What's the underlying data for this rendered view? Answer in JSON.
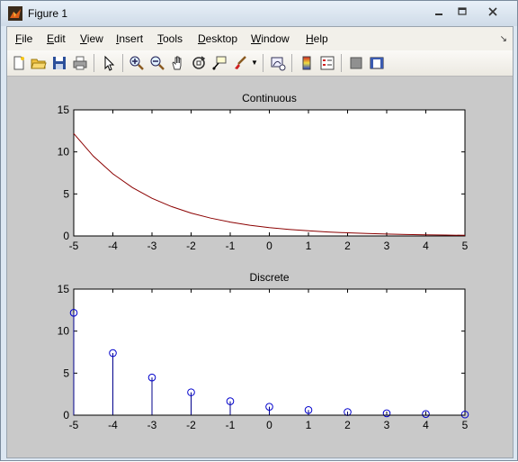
{
  "window": {
    "title": "Figure 1",
    "controls": [
      "minimize",
      "maximize",
      "close"
    ]
  },
  "menu": {
    "items": [
      {
        "label": "File",
        "accel": "F",
        "rest": "ile"
      },
      {
        "label": "Edit",
        "accel": "E",
        "rest": "dit"
      },
      {
        "label": "View",
        "accel": "V",
        "rest": "iew"
      },
      {
        "label": "Insert",
        "accel": "I",
        "rest": "nsert"
      },
      {
        "label": "Tools",
        "accel": "T",
        "rest": "ools"
      },
      {
        "label": "Desktop",
        "accel": "D",
        "rest": "esktop"
      },
      {
        "label": "Window",
        "accel": "W",
        "rest": "indow"
      },
      {
        "label": "Help",
        "accel": "H",
        "rest": "elp"
      }
    ]
  },
  "toolbar": {
    "icons": [
      "new-figure-icon",
      "open-file-icon",
      "save-icon",
      "print-icon",
      "pointer-icon",
      "zoom-in-icon",
      "zoom-out-icon",
      "pan-icon",
      "rotate-3d-icon",
      "data-cursor-icon",
      "brush-icon",
      "link-plot-icon",
      "colorbar-icon",
      "legend-icon",
      "hide-plot-tools-icon",
      "show-plot-tools-icon"
    ]
  },
  "chart_data": [
    {
      "type": "line",
      "title": "Continuous",
      "xlabel": "",
      "ylabel": "",
      "xlim": [
        -5,
        5
      ],
      "ylim": [
        0,
        15
      ],
      "xticks": [
        -5,
        -4,
        -3,
        -2,
        -1,
        0,
        1,
        2,
        3,
        4,
        5
      ],
      "yticks": [
        0,
        5,
        10,
        15
      ],
      "color": "#8b0000",
      "x": [
        -5,
        -4.5,
        -4,
        -3.5,
        -3,
        -2.5,
        -2,
        -1.5,
        -1,
        -0.5,
        0,
        0.5,
        1,
        1.5,
        2,
        2.5,
        3,
        3.5,
        4,
        4.5,
        5
      ],
      "y": [
        12.18,
        9.49,
        7.39,
        5.75,
        4.48,
        3.49,
        2.72,
        2.12,
        1.65,
        1.28,
        1.0,
        0.78,
        0.61,
        0.47,
        0.37,
        0.29,
        0.22,
        0.17,
        0.14,
        0.11,
        0.08
      ]
    },
    {
      "type": "stem",
      "title": "Discrete",
      "xlabel": "",
      "ylabel": "",
      "xlim": [
        -5,
        5
      ],
      "ylim": [
        0,
        15
      ],
      "xticks": [
        -5,
        -4,
        -3,
        -2,
        -1,
        0,
        1,
        2,
        3,
        4,
        5
      ],
      "yticks": [
        0,
        5,
        10,
        15
      ],
      "color": "#00008b",
      "x": [
        -5,
        -4,
        -3,
        -2,
        -1,
        0,
        1,
        2,
        3,
        4,
        5
      ],
      "y": [
        12.18,
        7.39,
        4.48,
        2.72,
        1.65,
        1.0,
        0.61,
        0.37,
        0.22,
        0.14,
        0.08
      ]
    }
  ]
}
